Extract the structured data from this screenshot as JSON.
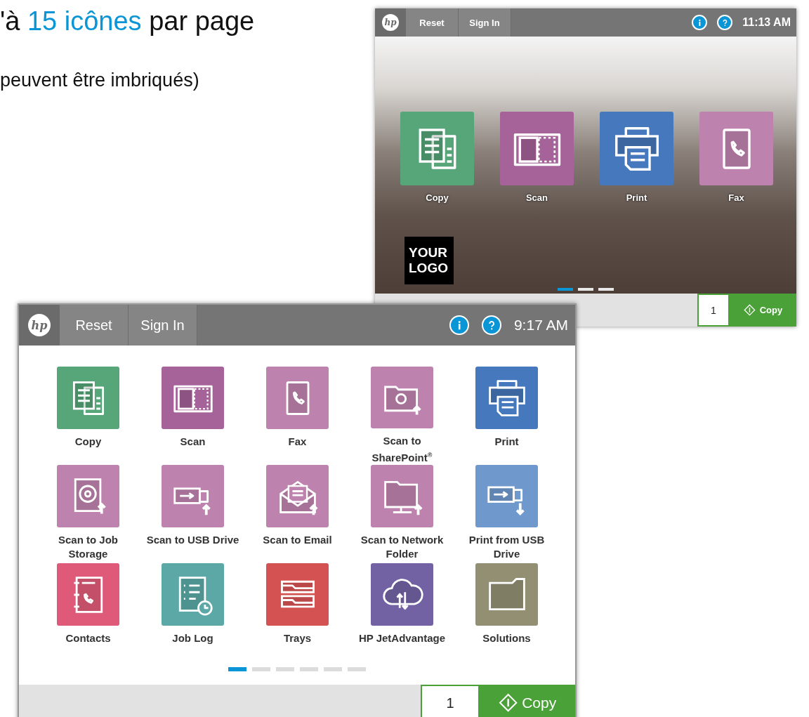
{
  "headline": {
    "lines": [
      {
        "kind": "title",
        "parts": [
          {
            "text": "'à ",
            "highlight": false
          },
          {
            "text": "15 icônes",
            "highlight": true
          },
          {
            "text": " par page",
            "highlight": false
          }
        ]
      },
      {
        "kind": "subtitle",
        "parts": [
          {
            "text": "peuvent être imbriqués)",
            "highlight": false
          }
        ]
      }
    ]
  },
  "screens": [
    {
      "kind": "photo",
      "header": {
        "logo": "hp",
        "buttons": [
          "Reset",
          "Sign In"
        ],
        "time": "11:13 AM"
      },
      "apps": [
        {
          "kind": "copy",
          "label": "Copy",
          "color": "#56a67a"
        },
        {
          "kind": "scan",
          "label": "Scan",
          "color": "#a6639a"
        },
        {
          "kind": "print",
          "label": "Print",
          "color": "#4678bd"
        },
        {
          "kind": "fax",
          "label": "Fax",
          "color": "#be82ae"
        }
      ],
      "logo_block": "YOUR LOGO",
      "pages": [
        {
          "selected": true
        },
        {
          "selected": false
        },
        {
          "selected": false
        }
      ],
      "footer": {
        "count": "1",
        "action": "Copy"
      }
    },
    {
      "kind": "grid",
      "header": {
        "logo": "hp",
        "buttons": [
          "Reset",
          "Sign In"
        ],
        "time": "9:17 AM"
      },
      "apps": [
        {
          "kind": "copy",
          "label": "Copy",
          "color": "#56a67a"
        },
        {
          "kind": "scan",
          "label": "Scan",
          "color": "#a6639a"
        },
        {
          "kind": "fax",
          "label": "Fax",
          "color": "#be82ae"
        },
        {
          "kind": "sharepoint",
          "label": "Scan to SharePoint$^{®}$",
          "color": "#be82ae"
        },
        {
          "kind": "print",
          "label": "Print",
          "color": "#4678bd"
        },
        {
          "kind": "storage",
          "label": "Scan to Job Storage",
          "color": "#be82ae"
        },
        {
          "kind": "usb",
          "label": "Scan to USB Drive",
          "color": "#be82ae"
        },
        {
          "kind": "email",
          "label": "Scan to Email",
          "color": "#be82ae"
        },
        {
          "kind": "network",
          "label": "Scan to Network Folder",
          "color": "#be82ae"
        },
        {
          "kind": "usbprint",
          "label": "Print from USB Drive",
          "color": "#6f98cc"
        },
        {
          "kind": "contacts",
          "label": "Contacts",
          "color": "#de5a78"
        },
        {
          "kind": "joblog",
          "label": "Job Log",
          "color": "#5ba8a6"
        },
        {
          "kind": "trays",
          "label": "Trays",
          "color": "#d55253"
        },
        {
          "kind": "cloud",
          "label": "HP JetAdvantage",
          "color": "#7262a3"
        },
        {
          "kind": "folder",
          "label": "Solutions",
          "color": "#928f73"
        }
      ],
      "pages": [
        {
          "selected": true
        },
        {
          "selected": false
        },
        {
          "selected": false
        },
        {
          "selected": false
        },
        {
          "selected": false
        },
        {
          "selected": false
        }
      ],
      "footer": {
        "count": "1",
        "action": "Copy"
      }
    }
  ]
}
